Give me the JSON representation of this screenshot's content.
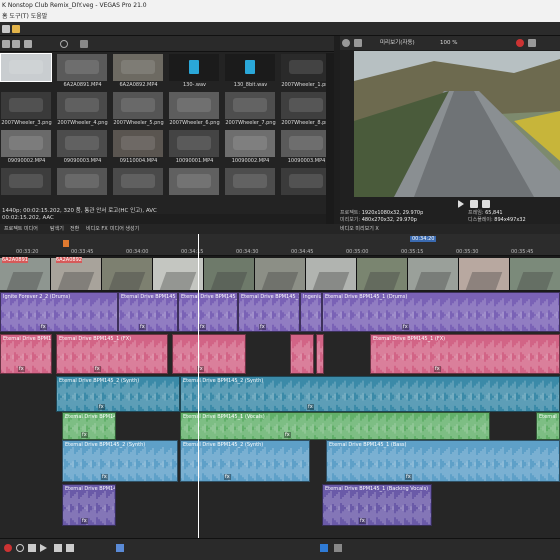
{
  "window": {
    "title": "K Nonstop Club Remix_DIY.veg - VEGAS Pro 21.0",
    "menu": "홈 도구(T) 도움말"
  },
  "media": {
    "items": [
      {
        "label": "",
        "selected": true
      },
      {
        "label": "6A2A0891.MP4"
      },
      {
        "label": "6A2A0892.MP4"
      },
      {
        "label": "130-.wav"
      },
      {
        "label": "130_8bit.wav"
      },
      {
        "label": "2007Wheeler_1.png"
      },
      {
        "label": "2007Wheeler_3.png"
      },
      {
        "label": "2007Wheeler_4.png"
      },
      {
        "label": "2007Wheeler_5.png"
      },
      {
        "label": "2007Wheeler_6.png"
      },
      {
        "label": "2007Wheeler_7.png"
      },
      {
        "label": "2007Wheeler_8.png"
      },
      {
        "label": "09090002.MP4"
      },
      {
        "label": "09090003.MP4"
      },
      {
        "label": "09110004.MP4"
      },
      {
        "label": "10090001.MP4"
      },
      {
        "label": "10090002.MP4"
      },
      {
        "label": "10090003.MP4"
      },
      {
        "label": "",
        "row": 4
      },
      {
        "label": ""
      },
      {
        "label": ""
      },
      {
        "label": ""
      },
      {
        "label": ""
      },
      {
        "label": ""
      }
    ],
    "status_line1": "1440p; 00:02:15.202, 320 품, 통관 안서 로고(HC 인고), AVC",
    "status_line2": "00:02:15.202, AAC"
  },
  "preview": {
    "mode": "미리보기(자동)",
    "zoom": "100 %",
    "project_label": "프로젝트:",
    "project_value": "1920x1080x32, 29.970p",
    "preview_label": "미리보기:",
    "preview_value": "480x270x32, 29.970p",
    "frame_label": "프레임:",
    "frame_value": "65,841",
    "display_label": "디스플레이:",
    "display_value": "894x497x32"
  },
  "tabs": {
    "left": [
      "프로젝트 미디어",
      "탐색기",
      "전환",
      "비디오 FX",
      "미디어 생성기"
    ],
    "right": "비디오 미리보기 X"
  },
  "timeline": {
    "ruler": [
      "00:33:20",
      "00:33:45",
      "00:34:00",
      "00:34:15",
      "00:34:30",
      "00:34:45",
      "00:35:00",
      "00:35:15",
      "00:35:30",
      "00:35:45"
    ],
    "timecode": "00:34:20",
    "video_events": [
      "6A2A0891",
      "6A2A0892"
    ],
    "tracks": [
      {
        "label": "Ignite Forever 2_2 (Drums)",
        "label2": "Eternal Drive BPM145_2 (Drums)",
        "label3": "Eternal Drive BPM145_2 (Drums)",
        "label4": "Eternal Drive BPM145_1 (Drums)",
        "label5": "Ingenium Eter...",
        "label6": "Eternal Drive BPM145_1 (Drums)"
      },
      {
        "label": "Eternal Drive BPM145_1 (FX)",
        "label2": "Eternal Drive BPM145_1 (FX)",
        "label3": "Eternal Drive BPM145_1 (FX)"
      },
      {
        "label": "Eternal Drive BPM145_2 (Synth)",
        "label2": "Eternal Drive BPM145_2 (Synth)"
      },
      {
        "label": "Eternal Drive BPM145_1",
        "label2": "Eternal Drive BPM145_1 (Vocals)",
        "label3": "Eternal Drive BPM145_1 (Vocals)"
      },
      {
        "label": "Eternal Drive BPM145_2 (Synth)",
        "label2": "Eternal Drive BPM145_2 (Synth)",
        "label3": "Eternal Drive BPM145_1 (Bass)"
      },
      {
        "label": "Eternal Drive BPM145_1 (Bass)",
        "label2": "Eternal Drive BPM145_1 (Backing Vocals)"
      }
    ],
    "fx_label": "fx"
  },
  "colors": {
    "drums": "#7a62b6",
    "fx": "#d26486",
    "synth": "#3b8aa8",
    "vocals": "#62b06a",
    "bass": "#5ea0c8",
    "backing": "#6a5aa8"
  }
}
